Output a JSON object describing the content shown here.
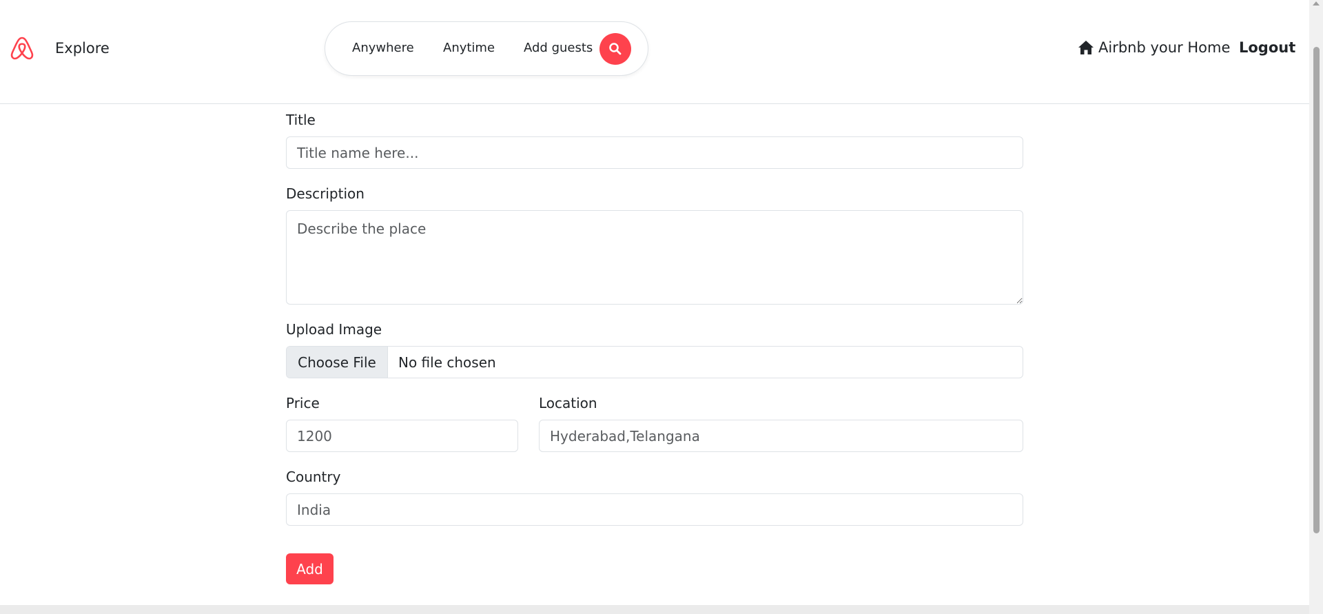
{
  "nav": {
    "brand_color": "#fe424d",
    "explore": "Explore",
    "search": {
      "anywhere": "Anywhere",
      "anytime": "Anytime",
      "add_guests": "Add guests",
      "icon": "search-icon"
    },
    "host_link": "Airbnb your Home",
    "host_icon": "house-icon",
    "logout": "Logout"
  },
  "form": {
    "title": {
      "label": "Title",
      "placeholder": "Title name here..."
    },
    "description": {
      "label": "Description",
      "placeholder": "Describe the place"
    },
    "image": {
      "label": "Upload Image",
      "button": "Choose File",
      "status": "No file chosen"
    },
    "price": {
      "label": "Price",
      "placeholder": "1200"
    },
    "location": {
      "label": "Location",
      "placeholder": "Hyderabad,Telangana"
    },
    "country": {
      "label": "Country",
      "placeholder": "India"
    },
    "submit": "Add"
  },
  "colors": {
    "accent": "#fe424d",
    "border": "#dee2e6",
    "text": "#212529"
  }
}
